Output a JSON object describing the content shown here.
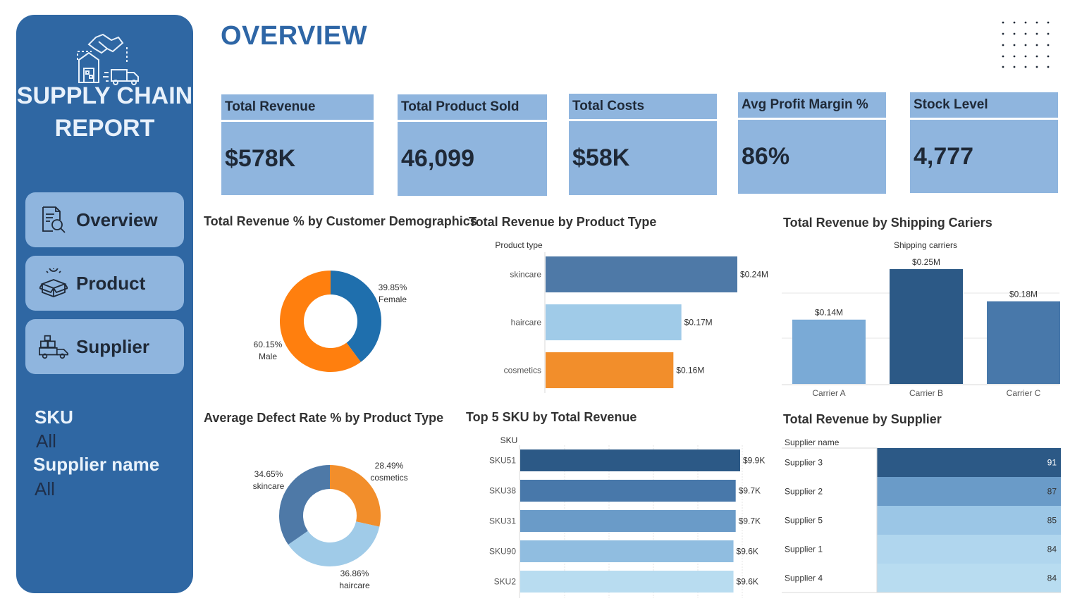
{
  "sidebar": {
    "title_line1": "SUPPLY CHAIN",
    "title_line2": "REPORT",
    "logo_icon": "supply-chain-logo-icon",
    "nav": [
      {
        "label": "Overview",
        "icon": "report-search-icon"
      },
      {
        "label": "Product",
        "icon": "product-box-icon"
      },
      {
        "label": "Supplier",
        "icon": "delivery-truck-icon"
      }
    ],
    "filters": [
      {
        "label": "SKU",
        "value": "All"
      },
      {
        "label": "Supplier name",
        "value": "All"
      }
    ]
  },
  "page": {
    "title": "OVERVIEW"
  },
  "kpis": [
    {
      "label": "Total Revenue",
      "value": "$578K"
    },
    {
      "label": "Total Product Sold",
      "value": "46,099"
    },
    {
      "label": "Total Costs",
      "value": "$58K"
    },
    {
      "label": "Avg Profit Margin %",
      "value": "86%"
    },
    {
      "label": "Stock Level",
      "value": "4,777"
    }
  ],
  "colors": {
    "sidebar": "#2f67a3",
    "accent": "#8fb5de",
    "orange": "#f28e2b",
    "blue": "#1f6fad"
  },
  "chart_data": [
    {
      "id": "demographics",
      "type": "pie",
      "title": "Total Revenue % by Customer Demographics",
      "slices": [
        {
          "name": "Female",
          "value": 39.85,
          "pct_label": "39.85%",
          "color": "#1f6fad"
        },
        {
          "name": "Male",
          "value": 60.15,
          "pct_label": "60.15%",
          "color": "#ff7f0e"
        }
      ]
    },
    {
      "id": "product_type",
      "type": "bar",
      "title": "Total Revenue by Product Type",
      "axis_title": "Product type",
      "categories": [
        "skincare",
        "haircare",
        "cosmetics"
      ],
      "values": [
        0.24,
        0.17,
        0.16
      ],
      "value_labels": [
        "$0.24M",
        "$0.17M",
        "$0.16M"
      ],
      "colors": [
        "#4e79a7",
        "#a0cbe8",
        "#f28e2b"
      ]
    },
    {
      "id": "shipping",
      "type": "bar",
      "title": "Total Revenue by Shipping Cariers",
      "axis_title": "Shipping carriers",
      "categories": [
        "Carrier A",
        "Carrier B",
        "Carrier C"
      ],
      "values": [
        0.14,
        0.25,
        0.18
      ],
      "value_labels": [
        "$0.14M",
        "$0.25M",
        "$0.18M"
      ],
      "colors": [
        "#7aaad6",
        "#2c5986",
        "#4878aa"
      ]
    },
    {
      "id": "defect",
      "type": "pie",
      "title": "Average Defect Rate % by Product Type",
      "slices": [
        {
          "name": "cosmetics",
          "value": 28.49,
          "pct_label": "28.49%",
          "color": "#f28e2b"
        },
        {
          "name": "haircare",
          "value": 36.86,
          "pct_label": "36.86%",
          "color": "#a0cbe8"
        },
        {
          "name": "skincare",
          "value": 34.65,
          "pct_label": "34.65%",
          "color": "#4e79a7"
        }
      ]
    },
    {
      "id": "top_sku",
      "type": "bar",
      "title": "Top 5 SKU by Total Revenue",
      "axis_title": "SKU",
      "categories": [
        "SKU51",
        "SKU38",
        "SKU31",
        "SKU90",
        "SKU2"
      ],
      "values": [
        9.9,
        9.7,
        9.7,
        9.6,
        9.6
      ],
      "value_labels": [
        "$9.9K",
        "$9.7K",
        "$9.7K",
        "$9.6K",
        "$9.6K"
      ],
      "colors": [
        "#2c5986",
        "#4878aa",
        "#6a9bc8",
        "#90bde0",
        "#b8dcf0"
      ]
    },
    {
      "id": "supplier",
      "type": "table",
      "title": "Total Revenue by Supplier",
      "axis_title": "Supplier name",
      "categories": [
        "Supplier 3",
        "Supplier 2",
        "Supplier 5",
        "Supplier 1",
        "Supplier 4"
      ],
      "values": [
        91,
        87,
        85,
        84,
        84
      ],
      "value_labels": [
        "91",
        "87",
        "85",
        "84",
        "84"
      ],
      "colors": [
        "#2c5986",
        "#6a9bc8",
        "#9bc6e6",
        "#b0d6ee",
        "#b8dcf0"
      ]
    }
  ]
}
